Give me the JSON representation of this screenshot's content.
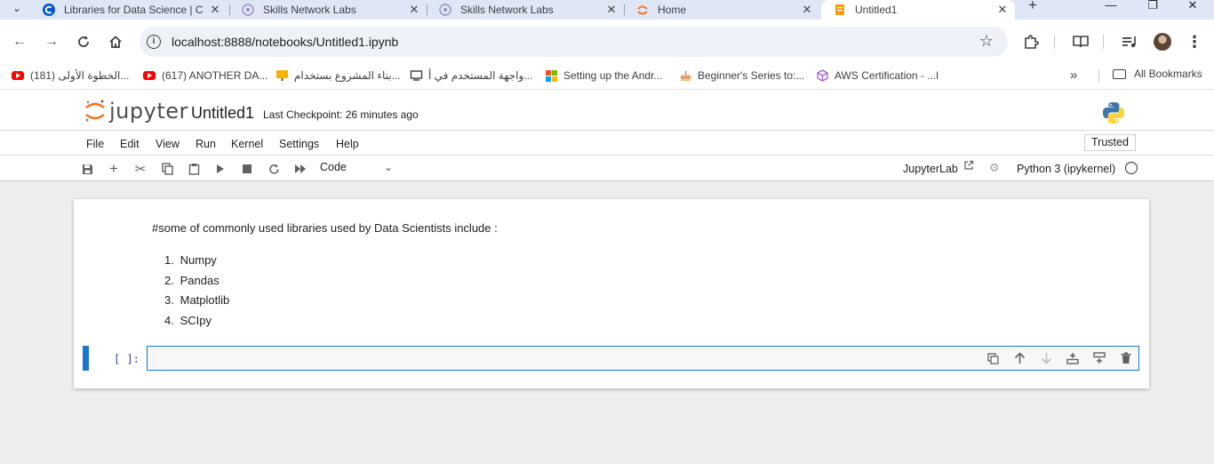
{
  "browser": {
    "tabs": [
      {
        "title": "Libraries for Data Science | C",
        "icon": "coursera-c-icon",
        "active": false
      },
      {
        "title": "Skills Network Labs",
        "icon": "skills-network-icon",
        "active": false
      },
      {
        "title": "Skills Network Labs",
        "icon": "skills-network-icon",
        "active": false
      },
      {
        "title": "Home",
        "icon": "jupyter-icon",
        "active": false
      },
      {
        "title": "Untitled1",
        "icon": "notebook-icon",
        "active": true
      }
    ],
    "address": {
      "url": "localhost:8888/notebooks/Untitled1.ipynb"
    },
    "bookmarks": [
      {
        "label": "(181) الخطوة الأولى...",
        "icon": "youtube-icon"
      },
      {
        "label": "(617) ANOTHER DA...",
        "icon": "youtube-icon"
      },
      {
        "label": "بناء المشروع بستخدام...",
        "icon": "presentation-icon"
      },
      {
        "label": "واجهة المستخدم في أ...",
        "icon": "screen-icon"
      },
      {
        "label": "Setting up the Andr...",
        "icon": "microsoft-icon"
      },
      {
        "label": "Beginner's Series to:...",
        "icon": "cake-icon"
      },
      {
        "label": "AWS Certification - ...l",
        "icon": "cube-icon"
      }
    ],
    "all_bookmarks": "All Bookmarks"
  },
  "jupyter": {
    "logo_text": "jupyter",
    "notebook_title": "Untitled1",
    "checkpoint": "Last Checkpoint: 26 minutes ago",
    "menu": [
      "File",
      "Edit",
      "View",
      "Run",
      "Kernel",
      "Settings",
      "Help"
    ],
    "trusted": "Trusted",
    "cell_type": "Code",
    "jupyterlab_link": "JupyterLab",
    "kernel_name": "Python 3 (ipykernel)"
  },
  "notebook": {
    "markdown_heading": "#some of commonly used libraries used by Data Scientists include :",
    "libraries": [
      {
        "num": "1.",
        "name": "Numpy"
      },
      {
        "num": "2.",
        "name": "Pandas"
      },
      {
        "num": "3.",
        "name": "Matplotlib"
      },
      {
        "num": "4.",
        "name": "SCIpy"
      }
    ],
    "code_prompt": "[ ]:",
    "code_value": ""
  }
}
